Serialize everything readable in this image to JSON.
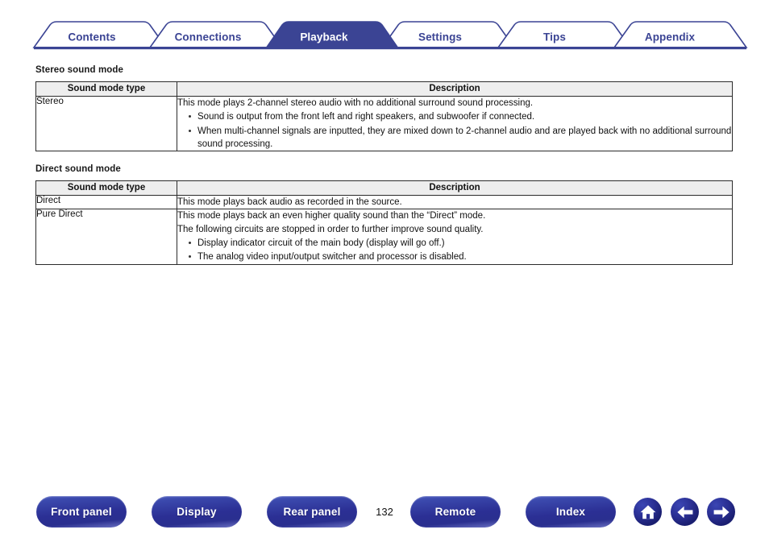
{
  "tabs": [
    {
      "label": "Contents",
      "active": false
    },
    {
      "label": "Connections",
      "active": false
    },
    {
      "label": "Playback",
      "active": true
    },
    {
      "label": "Settings",
      "active": false
    },
    {
      "label": "Tips",
      "active": false
    },
    {
      "label": "Appendix",
      "active": false
    }
  ],
  "sections": [
    {
      "heading": "Stereo sound mode",
      "columns": [
        "Sound mode type",
        "Description"
      ],
      "rows": [
        {
          "type": "Stereo",
          "lines": [
            "This mode plays 2-channel stereo audio with no additional surround sound processing."
          ],
          "bullets": [
            "Sound is output from the front left and right speakers, and subwoofer if connected.",
            "When multi-channel signals are inputted, they are mixed down to 2-channel audio and are played back with no additional surround sound processing."
          ]
        }
      ]
    },
    {
      "heading": "Direct sound mode",
      "columns": [
        "Sound mode type",
        "Description"
      ],
      "rows": [
        {
          "type": "Direct",
          "lines": [
            "This mode plays back audio as recorded in the source."
          ],
          "bullets": []
        },
        {
          "type": "Pure Direct",
          "lines": [
            "This mode plays back an even higher quality sound than the “Direct” mode.",
            "The following circuits are stopped in order to further improve sound quality."
          ],
          "bullets": [
            "Display indicator circuit of the main body (display will go off.)",
            "The analog video input/output switcher and processor is disabled."
          ]
        }
      ]
    }
  ],
  "footer": {
    "buttons": [
      {
        "label": "Front panel"
      },
      {
        "label": "Display"
      },
      {
        "label": "Rear panel"
      },
      {
        "label": "Remote"
      },
      {
        "label": "Index"
      }
    ],
    "page_number": "132",
    "icons": [
      {
        "name": "home-icon"
      },
      {
        "name": "arrow-left-icon"
      },
      {
        "name": "arrow-right-icon"
      }
    ]
  },
  "colors": {
    "navy": "#3b4494",
    "tab_active_fill": "#3b4494",
    "table_header_bg": "#eeeeee",
    "table_border": "#2b2b2b",
    "button_navy": "#2a2f8f"
  }
}
